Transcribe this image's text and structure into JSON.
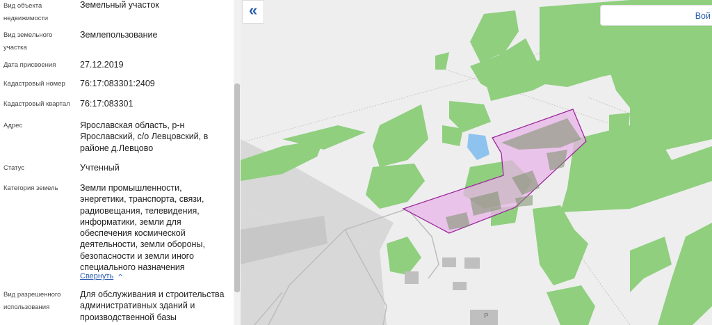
{
  "panel": {
    "rows": [
      {
        "label": "Вид объекта недвижимости",
        "value": "Земельный участок"
      },
      {
        "label": "Вид земельного участка",
        "value": "Землепользование"
      },
      {
        "label": "Дата присвоения",
        "value": "27.12.2019"
      },
      {
        "label": "Кадастровый номер",
        "value": "76:17:083301:2409"
      },
      {
        "label": "Кадастровый квартал",
        "value": "76:17:083301"
      },
      {
        "label": "Адрес",
        "value": "Ярославская область, р-н Ярославский, с/о Левцовский, в районе д.Левцово"
      },
      {
        "label": "Статус",
        "value": "Учтенный"
      },
      {
        "label": "Категория земель",
        "value": "Земли промышленности, энергетики, транспорта, связи, радиовещания, телевидения, информатики, земли для обеспечения космической деятельности, земли обороны, безопасности и земли иного специального назначения"
      },
      {
        "label": "Вид разрешенного использования",
        "value": "Для обслуживания и строительства административных зданий и производственной базы"
      }
    ],
    "collapse_label": "Свернуть"
  },
  "map": {
    "collapse_icon": "double-chevron-left-icon",
    "login_label": "Вой",
    "parking_label": "P",
    "colors": {
      "background": "#eeeeee",
      "vegetation": "#8fcf7e",
      "water": "#8ec3ef",
      "parcel_fill": "#e8b4e8",
      "parcel_stroke": "#9b2b9b",
      "road": "#d8d8d8"
    }
  }
}
